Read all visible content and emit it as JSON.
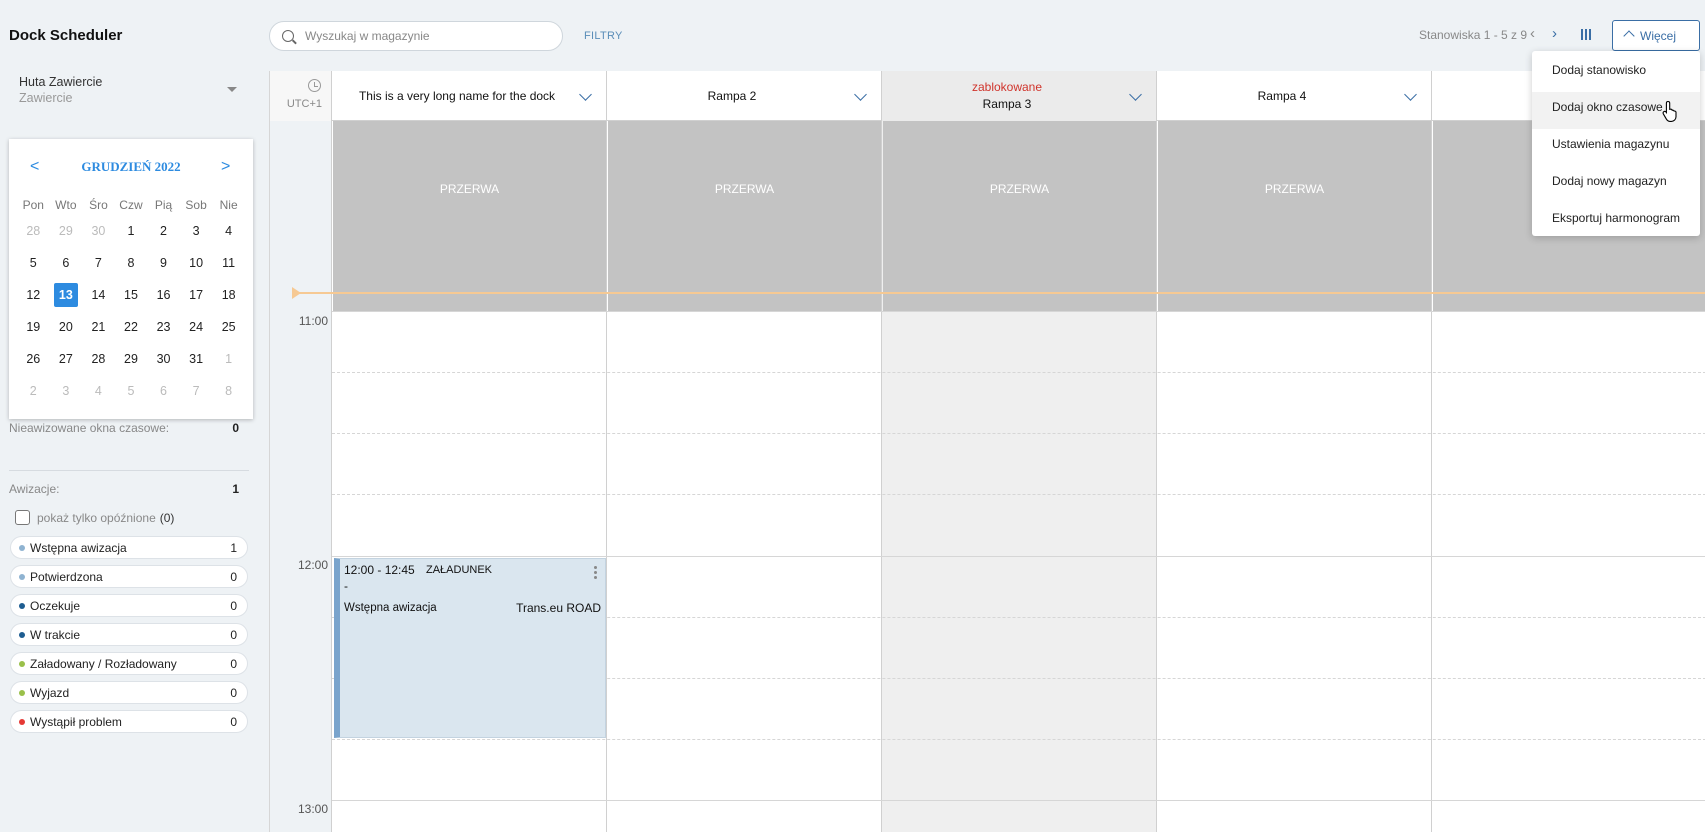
{
  "app": {
    "title": "Dock Scheduler"
  },
  "warehouse": {
    "name": "Huta Zawiercie",
    "city": "Zawiercie"
  },
  "calendar": {
    "prev": "<",
    "next": ">",
    "month_label": "GRUDZIEŃ 2022",
    "weekdays": [
      "Pon",
      "Wto",
      "Śro",
      "Czw",
      "Pią",
      "Sob",
      "Nie"
    ],
    "weeks": [
      [
        {
          "d": "28",
          "m": true
        },
        {
          "d": "29",
          "m": true
        },
        {
          "d": "30",
          "m": true
        },
        {
          "d": "1"
        },
        {
          "d": "2"
        },
        {
          "d": "3"
        },
        {
          "d": "4"
        }
      ],
      [
        {
          "d": "5"
        },
        {
          "d": "6"
        },
        {
          "d": "7"
        },
        {
          "d": "8"
        },
        {
          "d": "9"
        },
        {
          "d": "10"
        },
        {
          "d": "11"
        }
      ],
      [
        {
          "d": "12"
        },
        {
          "d": "13",
          "today": true
        },
        {
          "d": "14"
        },
        {
          "d": "15"
        },
        {
          "d": "16"
        },
        {
          "d": "17"
        },
        {
          "d": "18"
        }
      ],
      [
        {
          "d": "19"
        },
        {
          "d": "20"
        },
        {
          "d": "21"
        },
        {
          "d": "22"
        },
        {
          "d": "23"
        },
        {
          "d": "24"
        },
        {
          "d": "25"
        }
      ],
      [
        {
          "d": "26"
        },
        {
          "d": "27"
        },
        {
          "d": "28"
        },
        {
          "d": "29"
        },
        {
          "d": "30"
        },
        {
          "d": "31"
        },
        {
          "d": "1",
          "m": true
        }
      ],
      [
        {
          "d": "2",
          "m": true
        },
        {
          "d": "3",
          "m": true
        },
        {
          "d": "4",
          "m": true
        },
        {
          "d": "5",
          "m": true
        },
        {
          "d": "6",
          "m": true
        },
        {
          "d": "7",
          "m": true
        },
        {
          "d": "8",
          "m": true
        }
      ]
    ]
  },
  "stats": {
    "unadvised_label": "Nieawizowane okna czasowe:",
    "unadvised_value": "0",
    "advices_label": "Awizacje:",
    "advices_value": "1",
    "only_late_label": "pokaż tylko opóźnione",
    "only_late_count": "(0)"
  },
  "statuses": [
    {
      "label": "Wstępna awizacja",
      "count": "1",
      "color": "#8fb3d1"
    },
    {
      "label": "Potwierdzona",
      "count": "0",
      "color": "#8fb3d1"
    },
    {
      "label": "Oczekuje",
      "count": "0",
      "color": "#1e5d91"
    },
    {
      "label": "W trakcie",
      "count": "0",
      "color": "#1e5d91"
    },
    {
      "label": "Załadowany / Rozładowany",
      "count": "0",
      "color": "#9ac04a"
    },
    {
      "label": "Wyjazd",
      "count": "0",
      "color": "#9ac04a"
    },
    {
      "label": "Wystąpił problem",
      "count": "0",
      "color": "#e53935"
    }
  ],
  "search": {
    "placeholder": "Wyszukaj w magazynie"
  },
  "toolbar": {
    "filters": "FILTRY",
    "pager": "Stanowiska 1 - 5 z 9",
    "prev": "‹",
    "next": "›",
    "more": "Więcej"
  },
  "more_menu": [
    "Dodaj stanowisko",
    "Dodaj okno czasowe",
    "Ustawienia magazynu",
    "Dodaj nowy magazyn",
    "Eksportuj harmonogram"
  ],
  "scheduler": {
    "timezone": "UTC+1",
    "columns": [
      {
        "name": "This is a very long name for the dock",
        "blocked": false,
        "blocked_label": ""
      },
      {
        "name": "Rampa 2",
        "blocked": false,
        "blocked_label": ""
      },
      {
        "name": "Rampa 3",
        "blocked": true,
        "blocked_label": "zablokowane"
      },
      {
        "name": "Rampa 4",
        "blocked": false,
        "blocked_label": ""
      },
      {
        "name": "",
        "blocked": false,
        "blocked_label": ""
      }
    ],
    "break_label": "PRZERWA",
    "times": [
      "11:00",
      "12:00",
      "13:00"
    ],
    "event": {
      "time": "12:00 - 12:45",
      "type": "ZAŁADUNEK",
      "dash": "-",
      "status": "Wstępna awizacja",
      "carrier": "Trans.eu ROAD"
    }
  }
}
